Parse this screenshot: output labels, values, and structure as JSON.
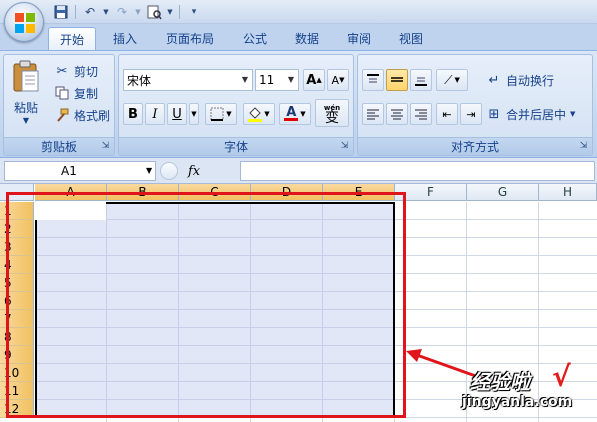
{
  "quick_access": {
    "icons": [
      "save-icon",
      "undo-icon",
      "redo-icon",
      "print-preview-icon",
      "customize-icon"
    ]
  },
  "tabs": [
    {
      "label": "开始",
      "active": true
    },
    {
      "label": "插入",
      "active": false
    },
    {
      "label": "页面布局",
      "active": false
    },
    {
      "label": "公式",
      "active": false
    },
    {
      "label": "数据",
      "active": false
    },
    {
      "label": "审阅",
      "active": false
    },
    {
      "label": "视图",
      "active": false
    }
  ],
  "clipboard": {
    "paste": "粘贴",
    "cut": "剪切",
    "copy": "复制",
    "format_painter": "格式刷",
    "group_label": "剪贴板"
  },
  "font": {
    "font_name": "宋体",
    "font_size": "11",
    "grow": "A",
    "shrink": "A",
    "bold": "B",
    "italic": "I",
    "underline": "U",
    "font_color_letter": "A",
    "phonetic": "变",
    "phonetic_small": "wén",
    "group_label": "字体"
  },
  "alignment": {
    "wrap_text": "自动换行",
    "merge_center": "合并后居中",
    "group_label": "对齐方式"
  },
  "formula_bar": {
    "name_box": "A1",
    "fx": "fx",
    "formula_value": ""
  },
  "grid": {
    "columns": [
      "A",
      "B",
      "C",
      "D",
      "E",
      "F",
      "G",
      "H"
    ],
    "rows": [
      "1",
      "2",
      "3",
      "4",
      "5",
      "6",
      "7",
      "8",
      "9",
      "10",
      "11",
      "12"
    ],
    "selected_columns": [
      "A",
      "B",
      "C",
      "D",
      "E"
    ],
    "selected_range": "A1:E12"
  },
  "annotation": {
    "highlight_color": "#e0141b"
  },
  "watermark": {
    "main": "经验啦",
    "check": "√",
    "url": "jingyanla.com"
  }
}
